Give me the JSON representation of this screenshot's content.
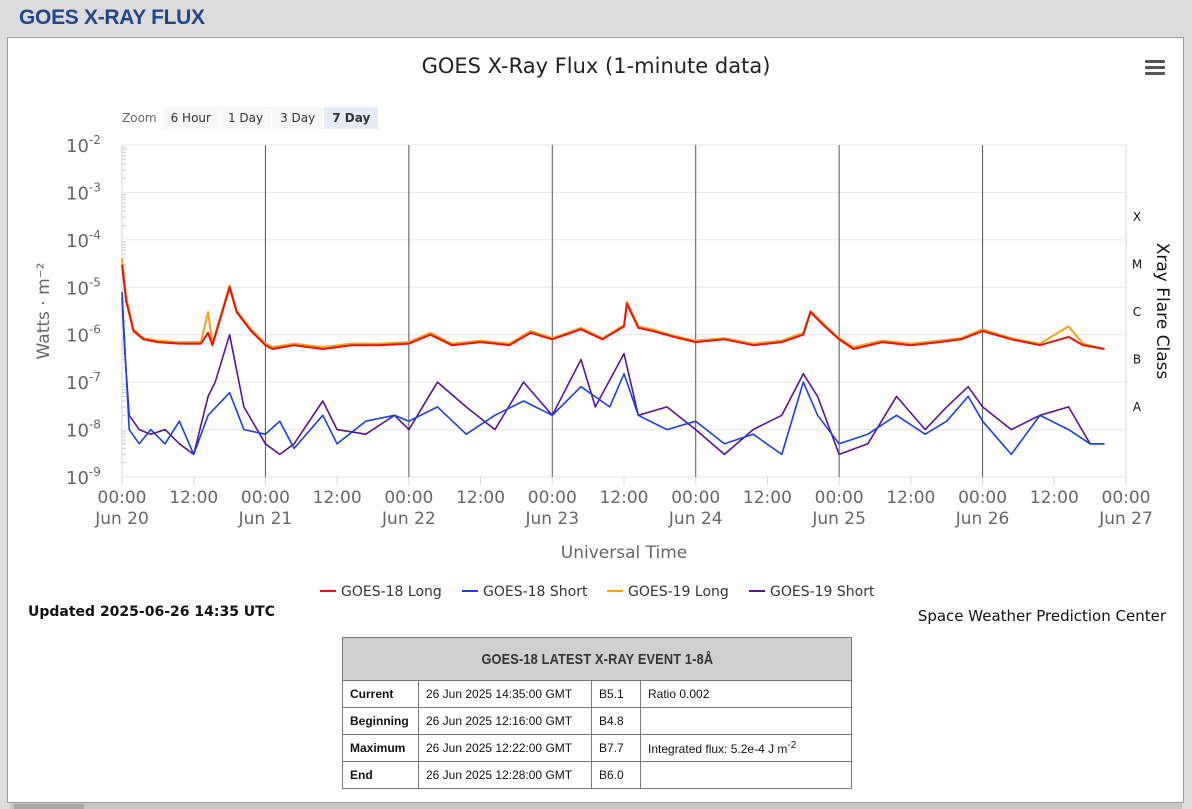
{
  "page": {
    "header": "GOES X-RAY FLUX",
    "updated": "Updated 2025-06-26 14:35 UTC",
    "credit": "Space Weather Prediction Center"
  },
  "zoom": {
    "label": "Zoom",
    "buttons": [
      "6 Hour",
      "1 Day",
      "3 Day",
      "7 Day"
    ],
    "active": "7 Day"
  },
  "colors": {
    "goes18_long": "#e8120f",
    "goes18_short": "#1b3fe0",
    "goes19_long": "#f6a21b",
    "goes19_short": "#5b1296",
    "header_text": "#22468b"
  },
  "chart_data": {
    "type": "line",
    "title": "GOES X-Ray Flux (1-minute data)",
    "ylabel": "Watts · m⁻²",
    "xlabel": "Universal Time",
    "ylabel_right": "Xray Flare Class",
    "y_scale": "log",
    "ylim": [
      1e-09,
      0.01
    ],
    "yticks": [
      {
        "base": "10",
        "exp": "-2"
      },
      {
        "base": "10",
        "exp": "-3"
      },
      {
        "base": "10",
        "exp": "-4"
      },
      {
        "base": "10",
        "exp": "-5"
      },
      {
        "base": "10",
        "exp": "-6"
      },
      {
        "base": "10",
        "exp": "-7"
      },
      {
        "base": "10",
        "exp": "-8"
      },
      {
        "base": "10",
        "exp": "-9"
      }
    ],
    "flare_classes": [
      "X",
      "M",
      "C",
      "B",
      "A"
    ],
    "xlim": [
      "2025-06-20 00:00",
      "2025-06-27 00:00"
    ],
    "xticks": [
      {
        "time": "00:00",
        "date": "Jun 20",
        "day": 0
      },
      {
        "time": "12:00",
        "date": "",
        "day": 0.5
      },
      {
        "time": "00:00",
        "date": "Jun 21",
        "day": 1
      },
      {
        "time": "12:00",
        "date": "",
        "day": 1.5
      },
      {
        "time": "00:00",
        "date": "Jun 22",
        "day": 2
      },
      {
        "time": "12:00",
        "date": "",
        "day": 2.5
      },
      {
        "time": "00:00",
        "date": "Jun 23",
        "day": 3
      },
      {
        "time": "12:00",
        "date": "",
        "day": 3.5
      },
      {
        "time": "00:00",
        "date": "Jun 24",
        "day": 4
      },
      {
        "time": "12:00",
        "date": "",
        "day": 4.5
      },
      {
        "time": "00:00",
        "date": "Jun 25",
        "day": 5
      },
      {
        "time": "12:00",
        "date": "",
        "day": 5.5
      },
      {
        "time": "00:00",
        "date": "Jun 26",
        "day": 6
      },
      {
        "time": "12:00",
        "date": "",
        "day": 6.5
      },
      {
        "time": "00:00",
        "date": "Jun 27",
        "day": 7
      }
    ],
    "series": [
      {
        "name": "GOES-18 Long",
        "key": "g18l",
        "color": "#e8120f",
        "points": [
          [
            0,
            3e-05
          ],
          [
            0.03,
            5e-06
          ],
          [
            0.08,
            1.2e-06
          ],
          [
            0.15,
            8e-07
          ],
          [
            0.25,
            7e-07
          ],
          [
            0.4,
            6.5e-07
          ],
          [
            0.55,
            6.5e-07
          ],
          [
            0.6,
            1.1e-06
          ],
          [
            0.63,
            6e-07
          ],
          [
            0.75,
            1e-05
          ],
          [
            0.8,
            3e-06
          ],
          [
            0.9,
            1.2e-06
          ],
          [
            1.0,
            6e-07
          ],
          [
            1.05,
            5e-07
          ],
          [
            1.2,
            6e-07
          ],
          [
            1.4,
            5e-07
          ],
          [
            1.6,
            6e-07
          ],
          [
            1.8,
            6e-07
          ],
          [
            2.0,
            6.5e-07
          ],
          [
            2.15,
            1e-06
          ],
          [
            2.3,
            6e-07
          ],
          [
            2.5,
            7e-07
          ],
          [
            2.7,
            6e-07
          ],
          [
            2.85,
            1.1e-06
          ],
          [
            3.0,
            8e-07
          ],
          [
            3.2,
            1.3e-06
          ],
          [
            3.35,
            8e-07
          ],
          [
            3.5,
            1.5e-06
          ],
          [
            3.52,
            4.5e-06
          ],
          [
            3.6,
            1.4e-06
          ],
          [
            3.7,
            1.2e-06
          ],
          [
            3.85,
            9e-07
          ],
          [
            4.0,
            7e-07
          ],
          [
            4.2,
            8e-07
          ],
          [
            4.4,
            6e-07
          ],
          [
            4.6,
            7e-07
          ],
          [
            4.75,
            1e-06
          ],
          [
            4.8,
            3e-06
          ],
          [
            4.9,
            1.5e-06
          ],
          [
            5.0,
            8e-07
          ],
          [
            5.1,
            5e-07
          ],
          [
            5.3,
            7e-07
          ],
          [
            5.5,
            6e-07
          ],
          [
            5.7,
            7e-07
          ],
          [
            5.85,
            8e-07
          ],
          [
            6.0,
            1.2e-06
          ],
          [
            6.2,
            8e-07
          ],
          [
            6.4,
            6e-07
          ],
          [
            6.6,
            9e-07
          ],
          [
            6.7,
            6e-07
          ],
          [
            6.85,
            5e-07
          ]
        ]
      },
      {
        "name": "GOES-18 Short",
        "key": "g18s",
        "color": "#1b3fe0",
        "points": [
          [
            0,
            8e-06
          ],
          [
            0.02,
            5e-07
          ],
          [
            0.05,
            1e-08
          ],
          [
            0.12,
            5e-09
          ],
          [
            0.2,
            1e-08
          ],
          [
            0.3,
            5e-09
          ],
          [
            0.4,
            1.5e-08
          ],
          [
            0.5,
            3e-09
          ],
          [
            0.6,
            2e-08
          ],
          [
            0.75,
            6e-08
          ],
          [
            0.85,
            1e-08
          ],
          [
            1.0,
            8e-09
          ],
          [
            1.1,
            1.5e-08
          ],
          [
            1.2,
            4e-09
          ],
          [
            1.4,
            2e-08
          ],
          [
            1.5,
            5e-09
          ],
          [
            1.7,
            1.5e-08
          ],
          [
            1.9,
            2e-08
          ],
          [
            2.0,
            1.5e-08
          ],
          [
            2.2,
            3e-08
          ],
          [
            2.4,
            8e-09
          ],
          [
            2.6,
            2e-08
          ],
          [
            2.8,
            4e-08
          ],
          [
            3.0,
            2e-08
          ],
          [
            3.2,
            8e-08
          ],
          [
            3.4,
            3e-08
          ],
          [
            3.5,
            1.5e-07
          ],
          [
            3.6,
            2e-08
          ],
          [
            3.8,
            1e-08
          ],
          [
            4.0,
            1.5e-08
          ],
          [
            4.2,
            5e-09
          ],
          [
            4.4,
            8e-09
          ],
          [
            4.6,
            3e-09
          ],
          [
            4.75,
            1e-07
          ],
          [
            4.85,
            2e-08
          ],
          [
            5.0,
            5e-09
          ],
          [
            5.2,
            8e-09
          ],
          [
            5.4,
            2e-08
          ],
          [
            5.6,
            8e-09
          ],
          [
            5.75,
            1.5e-08
          ],
          [
            5.9,
            5e-08
          ],
          [
            6.0,
            1.5e-08
          ],
          [
            6.2,
            3e-09
          ],
          [
            6.4,
            2e-08
          ],
          [
            6.6,
            1e-08
          ],
          [
            6.75,
            5e-09
          ],
          [
            6.85,
            5e-09
          ]
        ]
      },
      {
        "name": "GOES-19 Long",
        "key": "g19l",
        "color": "#f6a21b",
        "points": [
          [
            0,
            4e-05
          ],
          [
            0.03,
            6e-06
          ],
          [
            0.08,
            1.3e-06
          ],
          [
            0.15,
            8.5e-07
          ],
          [
            0.25,
            7.5e-07
          ],
          [
            0.4,
            7e-07
          ],
          [
            0.55,
            7e-07
          ],
          [
            0.6,
            3e-06
          ],
          [
            0.63,
            6.5e-07
          ],
          [
            0.75,
            1.1e-05
          ],
          [
            0.8,
            3.2e-06
          ],
          [
            0.9,
            1.3e-06
          ],
          [
            1.0,
            6.5e-07
          ],
          [
            1.05,
            5.5e-07
          ],
          [
            1.2,
            6.5e-07
          ],
          [
            1.4,
            5.5e-07
          ],
          [
            1.6,
            6.5e-07
          ],
          [
            1.8,
            6.5e-07
          ],
          [
            2.0,
            7e-07
          ],
          [
            2.15,
            1.1e-06
          ],
          [
            2.3,
            6.5e-07
          ],
          [
            2.5,
            7.5e-07
          ],
          [
            2.7,
            6.5e-07
          ],
          [
            2.85,
            1.2e-06
          ],
          [
            3.0,
            8.5e-07
          ],
          [
            3.2,
            1.4e-06
          ],
          [
            3.35,
            8.5e-07
          ],
          [
            3.5,
            1.6e-06
          ],
          [
            3.52,
            5e-06
          ],
          [
            3.6,
            1.5e-06
          ],
          [
            3.7,
            1.3e-06
          ],
          [
            3.85,
            9.5e-07
          ],
          [
            4.0,
            7.5e-07
          ],
          [
            4.2,
            8.5e-07
          ],
          [
            4.4,
            6.5e-07
          ],
          [
            4.6,
            7.5e-07
          ],
          [
            4.75,
            1.1e-06
          ],
          [
            4.8,
            3.2e-06
          ],
          [
            4.9,
            1.6e-06
          ],
          [
            5.0,
            8.5e-07
          ],
          [
            5.1,
            5.5e-07
          ],
          [
            5.3,
            7.5e-07
          ],
          [
            5.5,
            6.5e-07
          ],
          [
            5.7,
            7.5e-07
          ],
          [
            5.85,
            8.5e-07
          ],
          [
            6.0,
            1.3e-06
          ],
          [
            6.2,
            8.5e-07
          ],
          [
            6.4,
            6.5e-07
          ],
          [
            6.6,
            1.5e-06
          ],
          [
            6.7,
            6.5e-07
          ],
          [
            6.85,
            5e-07
          ]
        ]
      },
      {
        "name": "GOES-19 Short",
        "key": "g19s",
        "color": "#5b1296",
        "points": [
          [
            0,
            6e-06
          ],
          [
            0.02,
            4e-07
          ],
          [
            0.05,
            2e-08
          ],
          [
            0.12,
            1e-08
          ],
          [
            0.2,
            8e-09
          ],
          [
            0.3,
            1e-08
          ],
          [
            0.4,
            5e-09
          ],
          [
            0.5,
            3e-09
          ],
          [
            0.6,
            5e-08
          ],
          [
            0.65,
            1e-07
          ],
          [
            0.75,
            1e-06
          ],
          [
            0.85,
            3e-08
          ],
          [
            1.0,
            5e-09
          ],
          [
            1.1,
            3e-09
          ],
          [
            1.2,
            5e-09
          ],
          [
            1.4,
            4e-08
          ],
          [
            1.5,
            1e-08
          ],
          [
            1.7,
            8e-09
          ],
          [
            1.9,
            2e-08
          ],
          [
            2.0,
            1e-08
          ],
          [
            2.2,
            1e-07
          ],
          [
            2.4,
            3e-08
          ],
          [
            2.6,
            1e-08
          ],
          [
            2.8,
            1e-07
          ],
          [
            3.0,
            2e-08
          ],
          [
            3.2,
            3e-07
          ],
          [
            3.3,
            3e-08
          ],
          [
            3.5,
            4e-07
          ],
          [
            3.6,
            2e-08
          ],
          [
            3.8,
            3e-08
          ],
          [
            4.0,
            1e-08
          ],
          [
            4.2,
            3e-09
          ],
          [
            4.4,
            1e-08
          ],
          [
            4.6,
            2e-08
          ],
          [
            4.75,
            1.5e-07
          ],
          [
            4.85,
            5e-08
          ],
          [
            5.0,
            3e-09
          ],
          [
            5.2,
            5e-09
          ],
          [
            5.4,
            5e-08
          ],
          [
            5.6,
            1e-08
          ],
          [
            5.75,
            3e-08
          ],
          [
            5.9,
            8e-08
          ],
          [
            6.0,
            3e-08
          ],
          [
            6.2,
            1e-08
          ],
          [
            6.4,
            2e-08
          ],
          [
            6.6,
            3e-08
          ],
          [
            6.75,
            5e-09
          ],
          [
            6.85,
            5e-09
          ]
        ]
      }
    ]
  },
  "event_table": {
    "title": "GOES-18 LATEST X-RAY EVENT 1-8Å",
    "rows": [
      {
        "label": "Current",
        "time": "26 Jun 2025 14:35:00 GMT",
        "class": "B5.1",
        "extra": "Ratio 0.002",
        "sup": ""
      },
      {
        "label": "Beginning",
        "time": "26 Jun 2025 12:16:00 GMT",
        "class": "B4.8",
        "extra": "",
        "sup": ""
      },
      {
        "label": "Maximum",
        "time": "26 Jun 2025 12:22:00 GMT",
        "class": "B7.7",
        "extra": "Integrated flux: 5.2e-4 J m",
        "sup": "-2"
      },
      {
        "label": "End",
        "time": "26 Jun 2025 12:28:00 GMT",
        "class": "B6.0",
        "extra": "",
        "sup": ""
      }
    ]
  }
}
